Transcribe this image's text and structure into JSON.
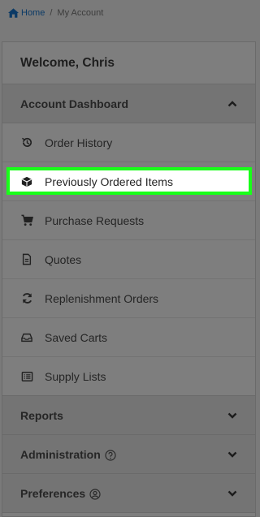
{
  "breadcrumb": {
    "home": "Home",
    "separator": "/",
    "current": "My Account"
  },
  "panel": {
    "welcome": "Welcome, Chris",
    "dashboard": {
      "title": "Account Dashboard",
      "items": [
        {
          "label": "Order History",
          "icon": "history-icon"
        },
        {
          "label": "Previously Ordered Items",
          "icon": "box-icon"
        },
        {
          "label": "Purchase Requests",
          "icon": "cart-icon"
        },
        {
          "label": "Quotes",
          "icon": "document-icon"
        },
        {
          "label": "Replenishment Orders",
          "icon": "refresh-icon"
        },
        {
          "label": "Saved Carts",
          "icon": "inbox-icon"
        },
        {
          "label": "Supply Lists",
          "icon": "list-icon"
        }
      ]
    },
    "reports": {
      "title": "Reports"
    },
    "administration": {
      "title": "Administration"
    },
    "preferences": {
      "title": "Preferences"
    }
  },
  "colors": {
    "highlight_border": "#19ff19",
    "link": "#0b3a66"
  }
}
